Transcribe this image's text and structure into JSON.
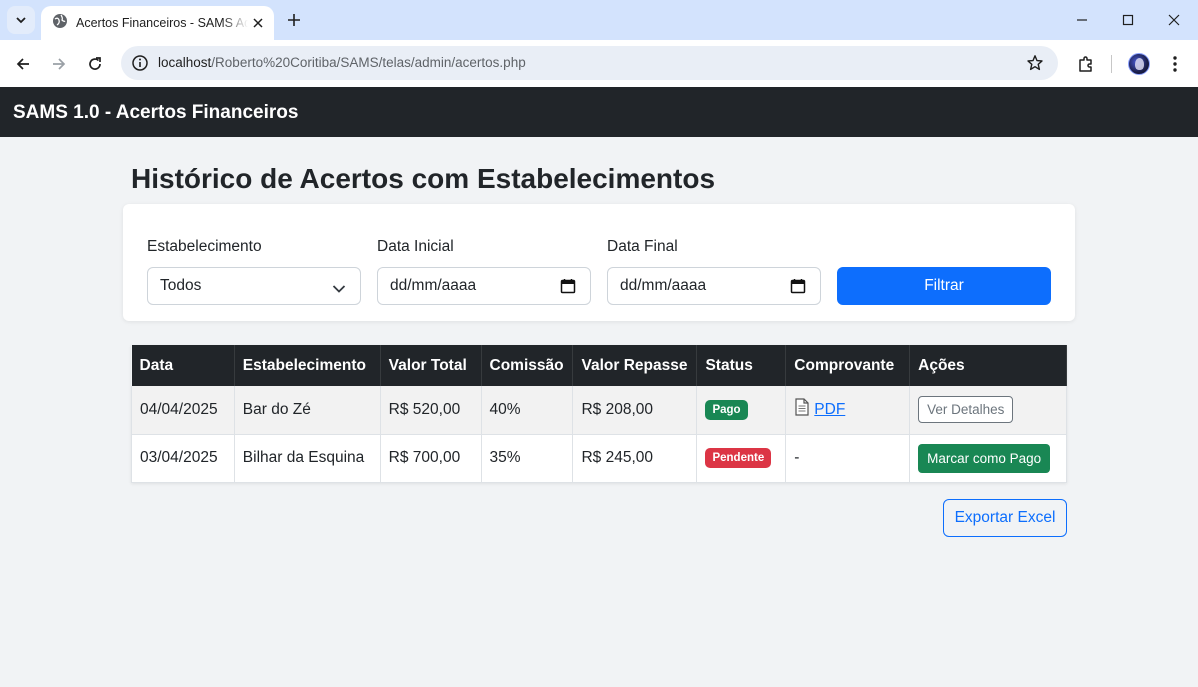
{
  "browser": {
    "tab_title": "Acertos Financeiros - SAMS Admin",
    "url_host": "localhost",
    "url_path": "/Roberto%20Coritiba/SAMS/telas/admin/acertos.php"
  },
  "navbar": {
    "brand": "SAMS 1.0 - Acertos Financeiros"
  },
  "page": {
    "title": "Histórico de Acertos com Estabelecimentos"
  },
  "filters": {
    "estabelecimento_label": "Estabelecimento",
    "estabelecimento_value": "Todos",
    "data_inicial_label": "Data Inicial",
    "data_inicial_placeholder": "dd/mm/aaaa",
    "data_final_label": "Data Final",
    "data_final_placeholder": "dd/mm/aaaa",
    "filtrar_label": "Filtrar"
  },
  "table": {
    "headers": [
      "Data",
      "Estabelecimento",
      "Valor Total",
      "Comissão",
      "Valor Repasse",
      "Status",
      "Comprovante",
      "Ações"
    ],
    "rows": [
      {
        "data": "04/04/2025",
        "estabelecimento": "Bar do Zé",
        "valor_total": "R$ 520,00",
        "comissao": "40%",
        "valor_repasse": "R$ 208,00",
        "status": "Pago",
        "comprovante": "PDF",
        "acao": "Ver Detalhes"
      },
      {
        "data": "03/04/2025",
        "estabelecimento": "Bilhar da Esquina",
        "valor_total": "R$ 700,00",
        "comissao": "35%",
        "valor_repasse": "R$ 245,00",
        "status": "Pendente",
        "comprovante": "-",
        "acao": "Marcar como Pago"
      }
    ]
  },
  "export_label": "Exportar Excel",
  "colors": {
    "primary": "#0d6efd",
    "success": "#198754",
    "danger": "#dc3545",
    "dark": "#212529"
  },
  "icons": [
    "tab-list-icon",
    "globe-icon",
    "close-icon",
    "plus-icon",
    "minimize-icon",
    "maximize-icon",
    "window-close-icon",
    "back-icon",
    "forward-icon",
    "reload-icon",
    "info-icon",
    "star-icon",
    "extensions-icon",
    "menu-icon",
    "chevron-down-icon",
    "calendar-icon",
    "document-icon"
  ]
}
